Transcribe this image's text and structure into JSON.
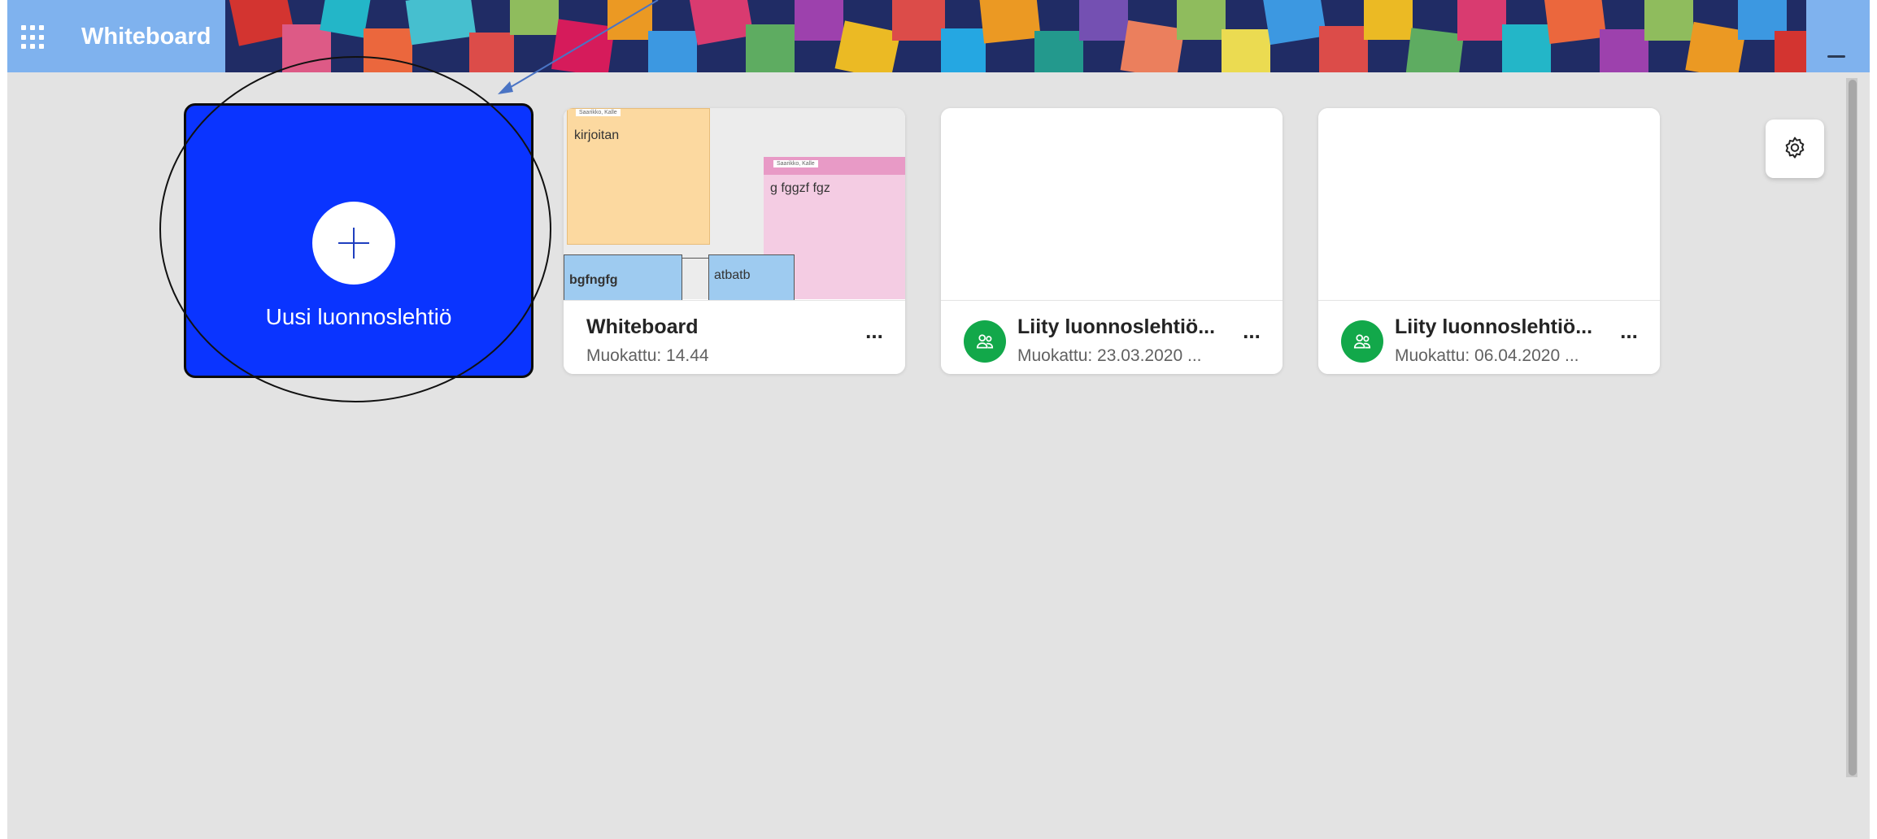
{
  "header": {
    "app_title": "Whiteboard",
    "waffle_icon": "app-launcher-icon"
  },
  "new_board": {
    "label": "Uusi luonnoslehtiö",
    "icon": "plus-icon",
    "accent": "#0a34ff"
  },
  "boards": [
    {
      "title": "Whiteboard",
      "modified": "Muokattu: 14.44",
      "thumbnail": {
        "notes": [
          {
            "author": "Saarikko, Kalle",
            "text": "kirjoitan"
          },
          {
            "author": "Saarikko, Kalle",
            "text": "g fggzf fgz"
          }
        ],
        "shapes": [
          "bgfngfg",
          "atbatb"
        ]
      }
    },
    {
      "title": "Liity luonnoslehtiö...",
      "modified": "Muokattu: 23.03.2020 ...",
      "icon": "shared-people-icon"
    },
    {
      "title": "Liity luonnoslehtiö...",
      "modified": "Muokattu: 06.04.2020 ...",
      "icon": "shared-people-icon"
    }
  ],
  "more_label": "...",
  "settings": {
    "icon": "gear-icon"
  },
  "colors": {
    "header": "#7fb2ee",
    "background": "#e3e3e3",
    "shared_avatar": "#12a84a"
  }
}
